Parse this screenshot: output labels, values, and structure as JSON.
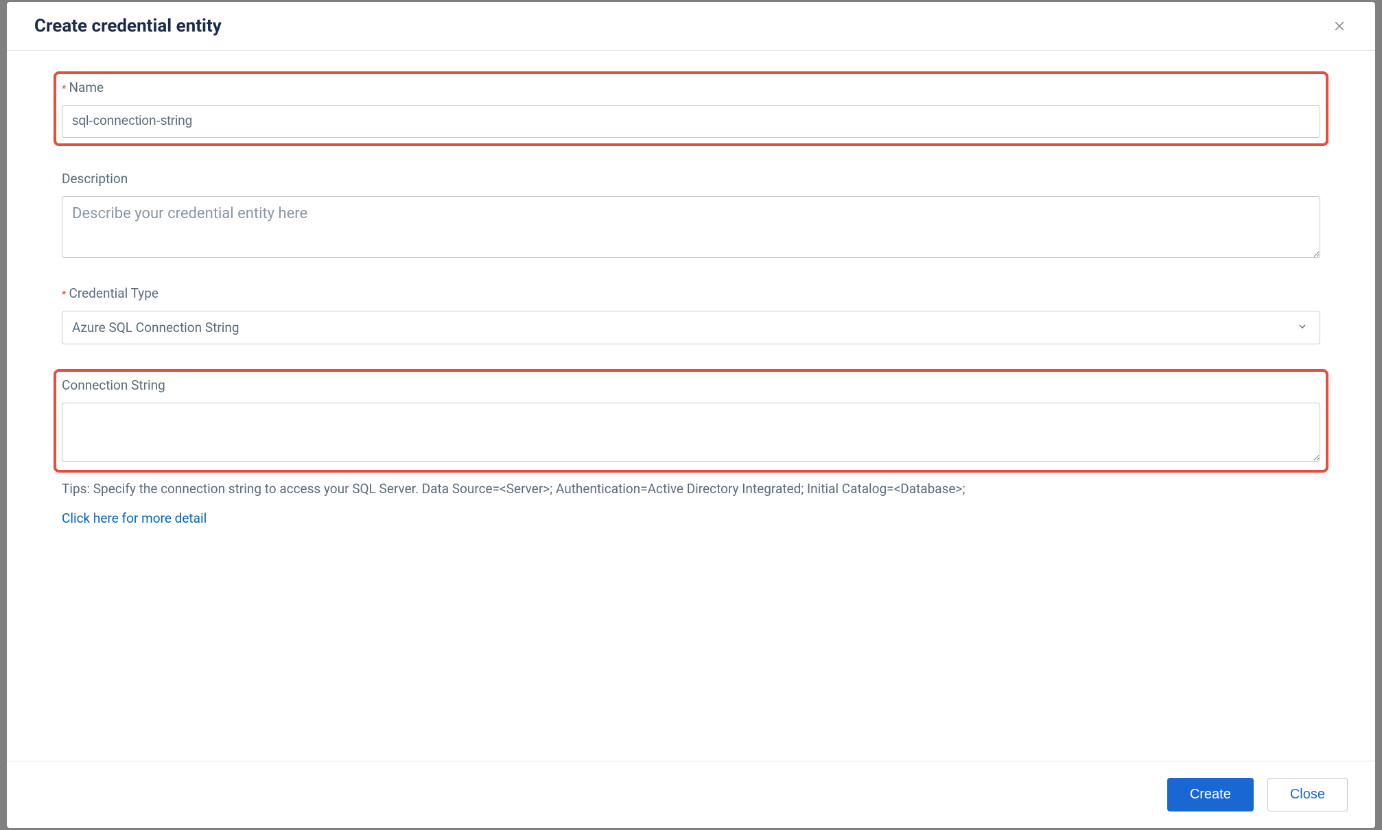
{
  "modal": {
    "title": "Create credential entity"
  },
  "form": {
    "name": {
      "label": "Name",
      "value": "sql-connection-string"
    },
    "description": {
      "label": "Description",
      "placeholder": "Describe your credential entity here"
    },
    "credentialType": {
      "label": "Credential Type",
      "value": "Azure SQL Connection String"
    },
    "connectionString": {
      "label": "Connection String",
      "value": ""
    },
    "tips": "Tips: Specify the connection string to access your SQL Server. Data Source=<Server>; Authentication=Active Directory Integrated; Initial Catalog=<Database>;",
    "moreDetailLink": "Click here for more detail"
  },
  "footer": {
    "createLabel": "Create",
    "closeLabel": "Close"
  }
}
